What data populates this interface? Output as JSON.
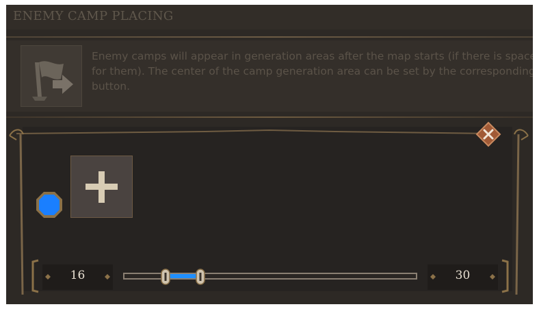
{
  "header": {
    "title": "ENEMY CAMP PLACING"
  },
  "description": {
    "icon": "flag-arrow-icon",
    "text": "Enemy camps will appear in generation areas after the map starts (if there is space for them). The center of the camp generation area can be set by the corresponding button."
  },
  "camp_area": {
    "close_icon": "close-icon",
    "color_icon": "blue-octagon-icon",
    "color": "#1a7fff",
    "add_icon": "plus-icon",
    "range": {
      "min_label": "16",
      "max_label": "30",
      "low_fraction": 0.14,
      "high_fraction": 0.26
    }
  },
  "colors": {
    "panel": "#2d2925",
    "accent_gold": "#8b7148",
    "close_orange": "#a15a36",
    "slider_blue": "#1f8fff"
  }
}
